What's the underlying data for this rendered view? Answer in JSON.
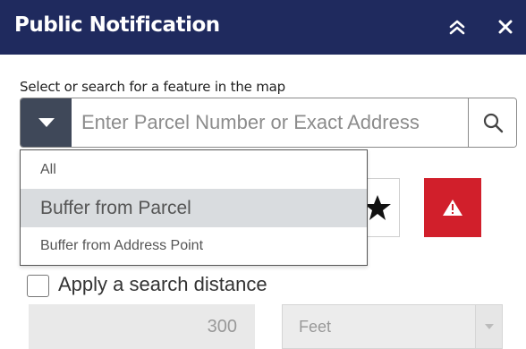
{
  "header": {
    "title": "Public Notification",
    "collapse_icon": "double-chevron-up-icon",
    "close_icon": "close-icon",
    "background_color": "#1f2a5e"
  },
  "search": {
    "prompt": "Select or search for a feature in the map",
    "placeholder": "Enter Parcel Number or Exact Address",
    "value": "",
    "dropdown_icon": "caret-down-icon",
    "search_icon": "search-icon"
  },
  "dropdown": {
    "options": [
      "All",
      "Buffer from Parcel",
      "Buffer from Address Point"
    ],
    "highlighted": "Buffer from Parcel"
  },
  "tools": {
    "select_icon": "star-icon",
    "warning_icon": "warning-icon",
    "warning_color": "#d11f2b"
  },
  "distance": {
    "checkbox_label": "Apply a search distance",
    "checked": false,
    "value": "300",
    "unit": "Feet"
  }
}
